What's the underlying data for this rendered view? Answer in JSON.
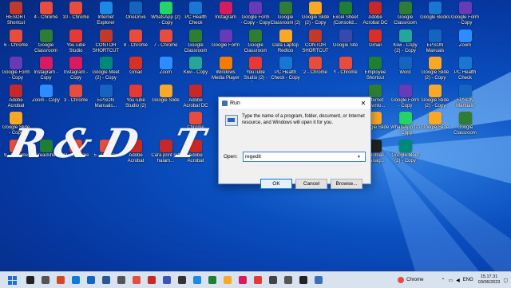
{
  "watermark": "R&D T",
  "icons": [
    {
      "label": "RESORT Shortcut",
      "color": "#c0392b"
    },
    {
      "label": "4 - Chrome",
      "color": "#e74c3c"
    },
    {
      "label": "10 - Chrome",
      "color": "#e74c3c"
    },
    {
      "label": "Internet Explorer",
      "color": "#1e88e5"
    },
    {
      "label": "OneDrive",
      "color": "#1565c0"
    },
    {
      "label": "WhatsApp (2) - Copy",
      "color": "#25d366"
    },
    {
      "label": "PC Health Check",
      "color": "#1976d2"
    },
    {
      "label": "Instagram",
      "color": "#d81b60"
    },
    {
      "label": "Google Form - Copy - Copy",
      "color": "#673ab7"
    },
    {
      "label": "Google Classroom (2)",
      "color": "#2e7d32"
    },
    {
      "label": "Google Slide (2) - Copy",
      "color": "#f9a825"
    },
    {
      "label": "Excel Sheet (Consolid...",
      "color": "#1e7e34"
    },
    {
      "label": "Adobe Acrobat DC",
      "color": "#c62828"
    },
    {
      "label": "Google Classroom",
      "color": "#2e7d32"
    },
    {
      "label": "Google Books",
      "color": "#1976d2"
    },
    {
      "label": "Google Form - Copy",
      "color": "#673ab7"
    },
    {
      "label": "6 - Chrome",
      "color": "#e74c3c"
    },
    {
      "label": "Google Classroom",
      "color": "#2e7d32"
    },
    {
      "label": "YouTube Studio",
      "color": "#e53935"
    },
    {
      "label": "CONTOH SHORTCUT",
      "color": "#c0392b"
    },
    {
      "label": "8 - Chrome",
      "color": "#e74c3c"
    },
    {
      "label": "7 - Chrome",
      "color": "#e74c3c"
    },
    {
      "label": "Google Classroom",
      "color": "#2e7d32"
    },
    {
      "label": "Google Form",
      "color": "#673ab7"
    },
    {
      "label": "Google Classroom",
      "color": "#2e7d32"
    },
    {
      "label": "Data Laptop Redtoo",
      "color": "#f9a825"
    },
    {
      "label": "CONTOH SHORTCUT",
      "color": "#c0392b"
    },
    {
      "label": "Google Site",
      "color": "#3949ab"
    },
    {
      "label": "Gmail",
      "color": "#d93025"
    },
    {
      "label": "Kiwi - Copy (2) - Copy",
      "color": "#26a69a"
    },
    {
      "label": "EPSON Manuals",
      "color": "#1565c0"
    },
    {
      "label": "Zoom",
      "color": "#2d8cff"
    },
    {
      "label": "Google Form - Copy",
      "color": "#673ab7"
    },
    {
      "label": "Instagram - Copy",
      "color": "#d81b60"
    },
    {
      "label": "Instagram - Copy",
      "color": "#d81b60"
    },
    {
      "label": "Google Meet (2) - Copy",
      "color": "#00897b"
    },
    {
      "label": "Gmail",
      "color": "#d93025"
    },
    {
      "label": "Zoom",
      "color": "#2d8cff"
    },
    {
      "label": "Kiwi - Copy",
      "color": "#26a69a"
    },
    {
      "label": "Windows Media Player",
      "color": "#f57c00"
    },
    {
      "label": "YouTube Studio (2) - Copy",
      "color": "#e53935"
    },
    {
      "label": "PC Health Check - Copy",
      "color": "#1976d2"
    },
    {
      "label": "2 - Chrome",
      "color": "#e74c3c"
    },
    {
      "label": "Y - Chrome",
      "color": "#e74c3c"
    },
    {
      "label": "Employee Shortcut",
      "color": "#1e7e34"
    },
    {
      "label": "Word",
      "color": "#1565c0"
    },
    {
      "label": "Google Slide (2) - Copy",
      "color": "#f9a825"
    },
    {
      "label": "PC Health Check",
      "color": "#1976d2"
    },
    {
      "label": "Adobe Acrobat",
      "color": "#c62828"
    },
    {
      "label": "Zoom - Copy",
      "color": "#2d8cff"
    },
    {
      "label": "3 - Chrome",
      "color": "#e74c3c"
    },
    {
      "label": "EPSON Manuals...",
      "color": "#1565c0"
    },
    {
      "label": "YouTube Studio (2)",
      "color": "#e53935"
    },
    {
      "label": "Google Slide",
      "color": "#f9a825"
    },
    {
      "label": "Adobe Acrobat DC",
      "color": "#c62828"
    },
    {
      "label": "Internet Downlo...",
      "color": "#2e7d32"
    },
    {
      "label": "Google Form - Copy",
      "color": "#673ab7"
    },
    {
      "label": "Google Slide (2) - Copy",
      "color": "#f9a825"
    },
    {
      "label": "EPSON Manuals",
      "color": "#1565c0"
    },
    {
      "label": "Google Slide - Copy",
      "color": "#f9a825"
    },
    {
      "label": "Chrome",
      "color": "#e74c3c"
    },
    {
      "label": "Google Slide",
      "color": "#f9a825"
    },
    {
      "label": "WhatsApp (2) - Copy",
      "color": "#25d366"
    },
    {
      "label": "Google Slide",
      "color": "#f9a825"
    },
    {
      "label": "Google Classroom",
      "color": "#2e7d32"
    },
    {
      "label": "9 - Chrome",
      "color": "#e74c3c"
    },
    {
      "label": "Spreadsheet",
      "color": "#1e7e34"
    },
    {
      "label": "11 - Chrome",
      "color": "#e74c3c"
    },
    {
      "label": "5 - Chrome",
      "color": "#e74c3c"
    },
    {
      "label": "Adobe Acrobat",
      "color": "#c62828"
    },
    {
      "label": "Cara print pdf halam...",
      "color": "#c62828"
    },
    {
      "label": "Adobe Acrobat",
      "color": "#c62828"
    },
    {
      "label": "Football Manag...",
      "color": "#212121"
    },
    {
      "label": "Google Meet (2) - Copy",
      "color": "#00897b"
    }
  ],
  "run_dialog": {
    "title": "Run",
    "close": "✕",
    "description": "Type the name of a program, folder, document, or Internet resource, and Windows will open it for you.",
    "open_label": "Open:",
    "open_value": "regedit",
    "ok_label": "OK",
    "cancel_label": "Cancel",
    "browse_label": "Browse..."
  },
  "taskbar": {
    "items": [
      {
        "icon": "search-icon",
        "color": "#222"
      },
      {
        "icon": "task-view-icon",
        "color": "#555"
      },
      {
        "icon": "powerpoint-icon",
        "color": "#d24726"
      },
      {
        "icon": "edge-icon",
        "color": "#0f7bd8"
      },
      {
        "icon": "mail-icon",
        "color": "#1565c0"
      },
      {
        "icon": "word-icon",
        "color": "#2b5797"
      },
      {
        "icon": "store-icon",
        "color": "#555"
      },
      {
        "icon": "chrome-icon",
        "color": "#e74c3c"
      },
      {
        "icon": "acrobat-icon",
        "color": "#c62828"
      },
      {
        "icon": "calendar-icon",
        "color": "#3f51b5"
      },
      {
        "icon": "calculator-icon",
        "color": "#333"
      },
      {
        "icon": "photos-icon",
        "color": "#1e88e5"
      },
      {
        "icon": "excel-icon",
        "color": "#1e7e34"
      },
      {
        "icon": "explorer-icon",
        "color": "#f9a825"
      },
      {
        "icon": "paint-icon",
        "color": "#d81b60"
      },
      {
        "icon": "anydesk-icon",
        "color": "#e53935"
      },
      {
        "icon": "camera-icon",
        "color": "#444"
      },
      {
        "icon": "settings-icon",
        "color": "#555"
      },
      {
        "icon": "terminal-icon",
        "color": "#222"
      },
      {
        "icon": "run-icon",
        "color": "#3c6fb7"
      }
    ],
    "tray_app": "Chrome",
    "language": "ENG",
    "time": "15.17.31",
    "date": "03/06/2023"
  }
}
